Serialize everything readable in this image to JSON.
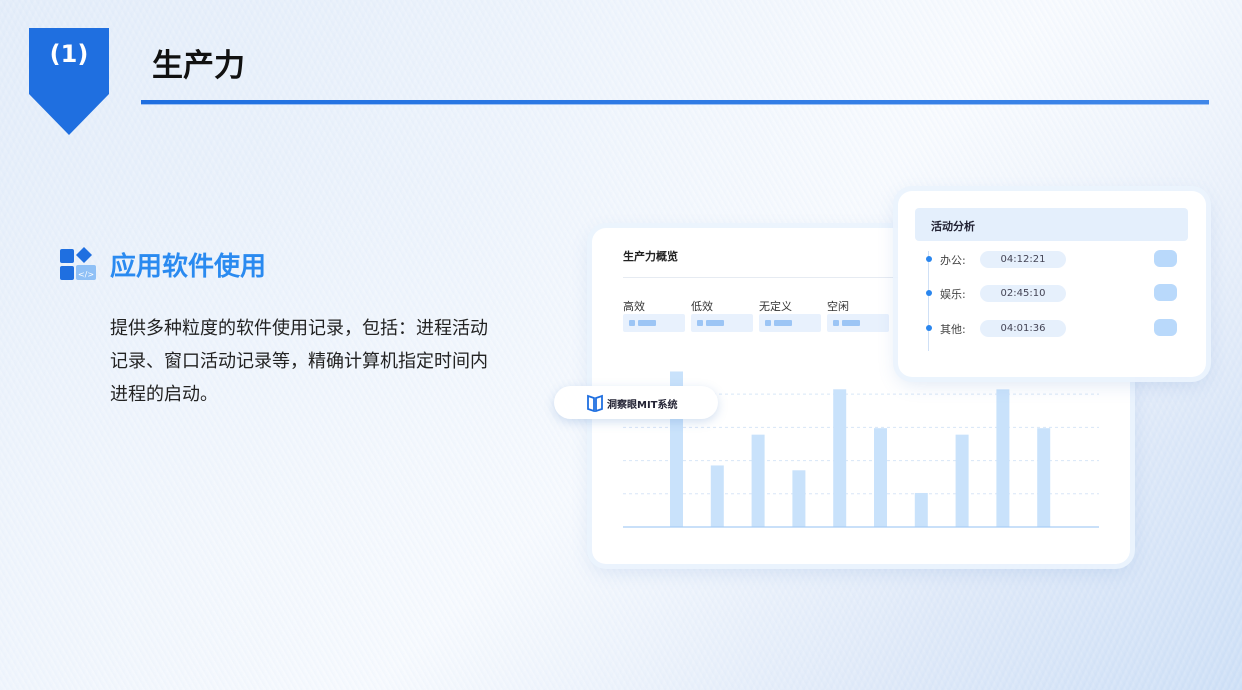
{
  "section": {
    "number": "(1)",
    "title": "生产力"
  },
  "feature": {
    "heading": "应用软件使用",
    "description": "提供多种粒度的软件使用记录，包括：进程活动记录、窗口活动记录等，精确计算机指定时间内进程的启动。"
  },
  "overview_card": {
    "title": "生产力概览",
    "categories": [
      "高效",
      "低效",
      "无定义",
      "空闲"
    ]
  },
  "brand_label": "洞察眼MIT系统",
  "activity_card": {
    "title": "活动分析",
    "rows": [
      {
        "label": "办公:",
        "time": "04:12:21"
      },
      {
        "label": "娱乐:",
        "time": "02:45:10"
      },
      {
        "label": "其他:",
        "time": "04:01:36"
      }
    ]
  },
  "chart_data": {
    "type": "bar",
    "values": [
      0.96,
      0.38,
      0.57,
      0.35,
      0.85,
      0.61,
      0.21,
      0.57,
      0.85,
      0.61
    ],
    "ylim": [
      0,
      1
    ],
    "grid": true
  },
  "colors": {
    "accent": "#1f6fe0",
    "heading": "#2a8af0",
    "bar": "#c9e2fb"
  },
  "icons": {
    "section_icon": "app-grid-icon",
    "brand_logo": "book-logo-icon"
  }
}
